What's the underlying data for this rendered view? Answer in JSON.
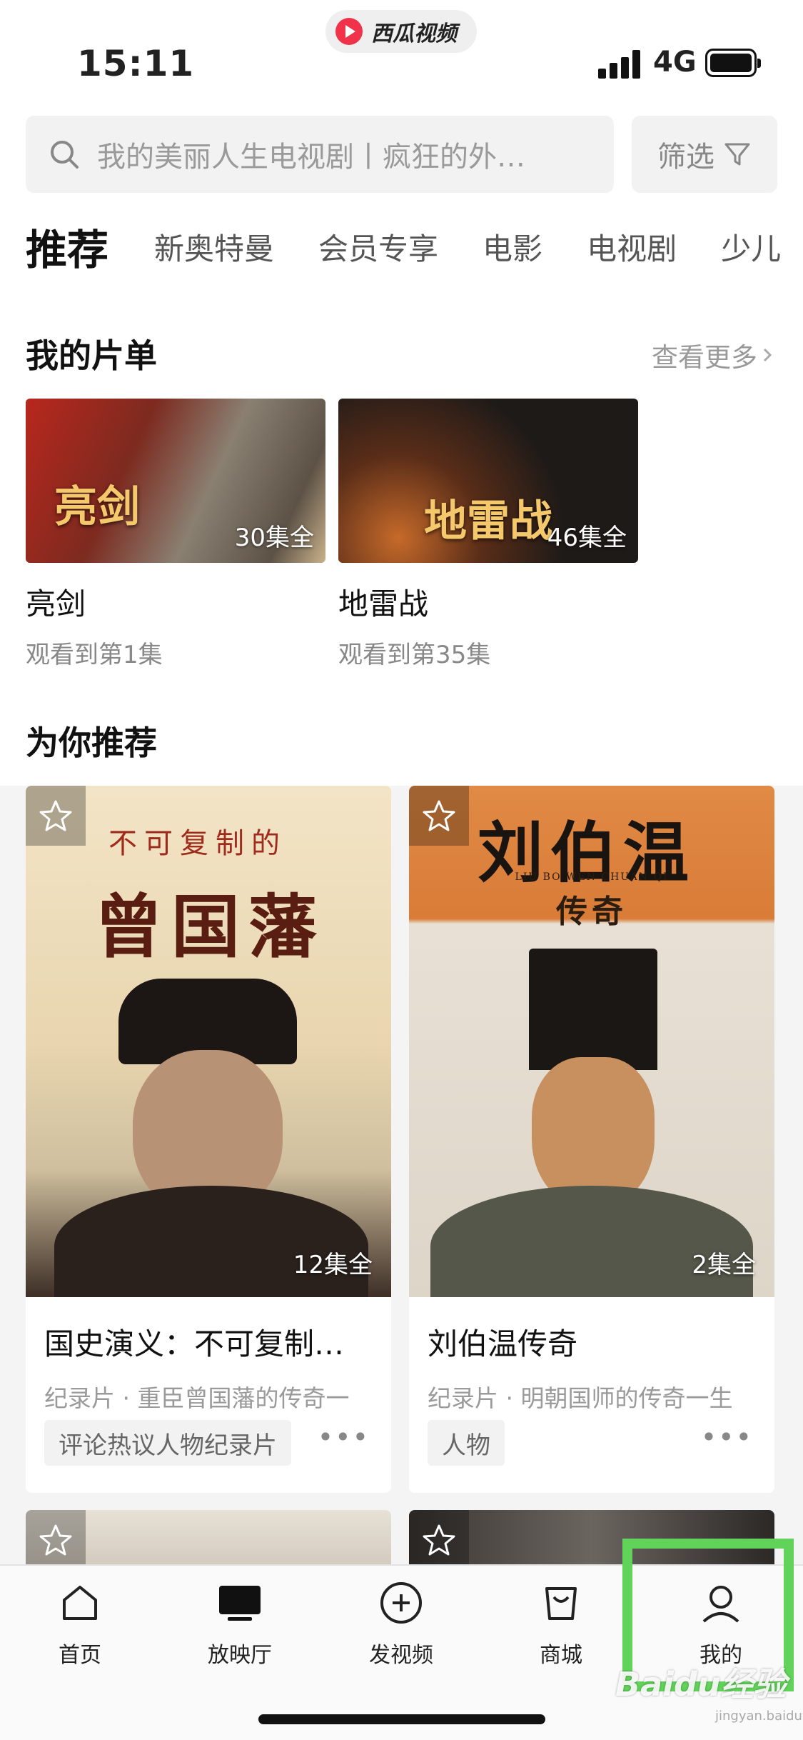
{
  "status_bar": {
    "time": "15:11",
    "network": "4G",
    "app_pill": "西瓜视频"
  },
  "search": {
    "placeholder": "我的美丽人生电视剧丨疯狂的外…",
    "filter_label": "筛选"
  },
  "tabs": [
    "推荐",
    "新奥特曼",
    "会员专享",
    "电影",
    "电视剧",
    "少儿"
  ],
  "playlist": {
    "title": "我的片单",
    "more_label": "查看更多",
    "items": [
      {
        "name": "亮剑",
        "progress": "观看到第1集",
        "episodes": "30集全",
        "art_text": "亮剑"
      },
      {
        "name": "地雷战",
        "progress": "观看到第35集",
        "episodes": "46集全",
        "art_text": "地雷战"
      }
    ]
  },
  "recommend": {
    "title": "为你推荐",
    "items": [
      {
        "title": "国史演义：不可复制…",
        "subtitle": "纪录片 · 重臣曾国藩的传奇一",
        "tag": "评论热议人物纪录片",
        "episodes": "12集全",
        "poster_top": "不可复制的",
        "poster_main": "曾国藩"
      },
      {
        "title": "刘伯温传奇",
        "subtitle": "纪录片 · 明朝国师的传奇一生",
        "tag": "人物",
        "episodes": "2集全",
        "poster_main": "刘伯温",
        "poster_pinyin": "LIU BO WEN CHUAN QI",
        "poster_sub": "传奇"
      }
    ]
  },
  "bottom_nav": [
    {
      "label": "首页",
      "icon": "home-icon"
    },
    {
      "label": "放映厅",
      "icon": "tv-icon"
    },
    {
      "label": "发视频",
      "icon": "plus-circle-icon"
    },
    {
      "label": "商城",
      "icon": "shopping-bag-icon"
    },
    {
      "label": "我的",
      "icon": "user-icon"
    }
  ],
  "watermark": {
    "text": "Baidu经验",
    "sub": "jingyan.baidu.com"
  },
  "colors": {
    "highlight": "#62d35a",
    "accent": "#f0334a"
  }
}
